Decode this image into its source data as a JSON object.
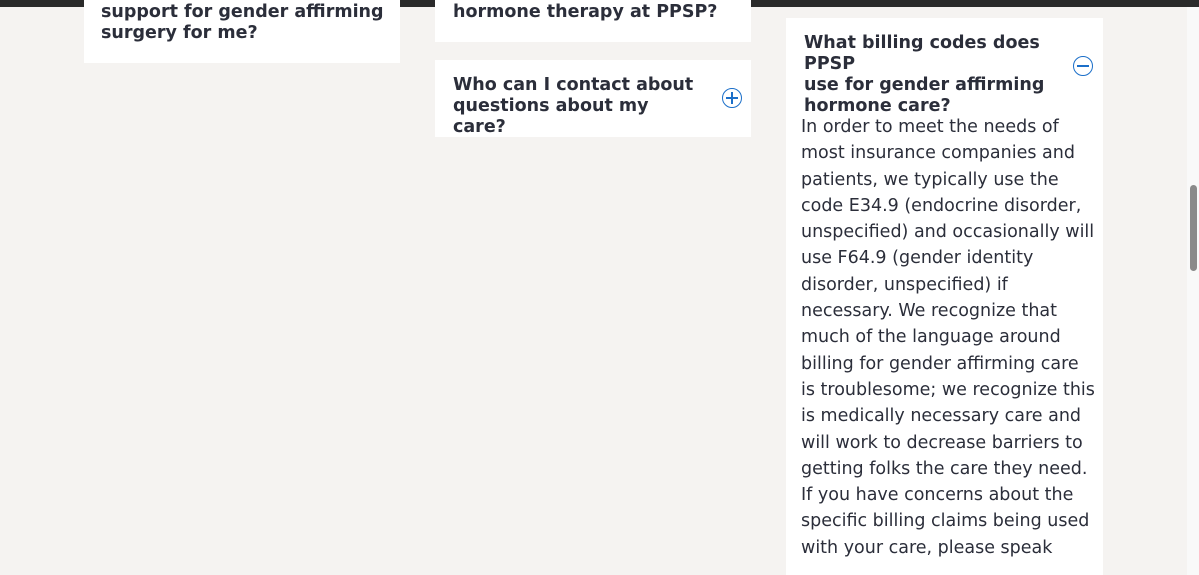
{
  "faq": {
    "item_surgery": {
      "question_line1": "support for gender affirming",
      "question_line2": "surgery for me?"
    },
    "item_hormone": {
      "question": "hormone therapy at PPSP?"
    },
    "item_contact": {
      "question_line1": "Who can I contact about",
      "question_line2": "questions about my care?",
      "toggle_icon": "plus-circle-icon"
    },
    "item_billing": {
      "question_line1": "What billing codes does PPSP",
      "question_line2": "use for gender affirming",
      "question_line3": "hormone care?",
      "toggle_icon": "minus-circle-icon",
      "answer": "In order to meet the needs of most insurance companies and patients, we typically use the code E34.9 (endocrine disorder, unspecified) and occasionally will use F64.9 (gender identity disorder, unspecified) if necessary. We recognize that much of the language around billing for gender affirming care is troublesome; we recognize this is medically necessary care and will work to decrease barriers to getting folks the care they need. If you have concerns about the specific billing claims being used with your care, please speak"
    }
  },
  "colors": {
    "background": "#f5f3f1",
    "card": "#ffffff",
    "text": "#2b2e3a",
    "accent": "#1b6fc9"
  }
}
